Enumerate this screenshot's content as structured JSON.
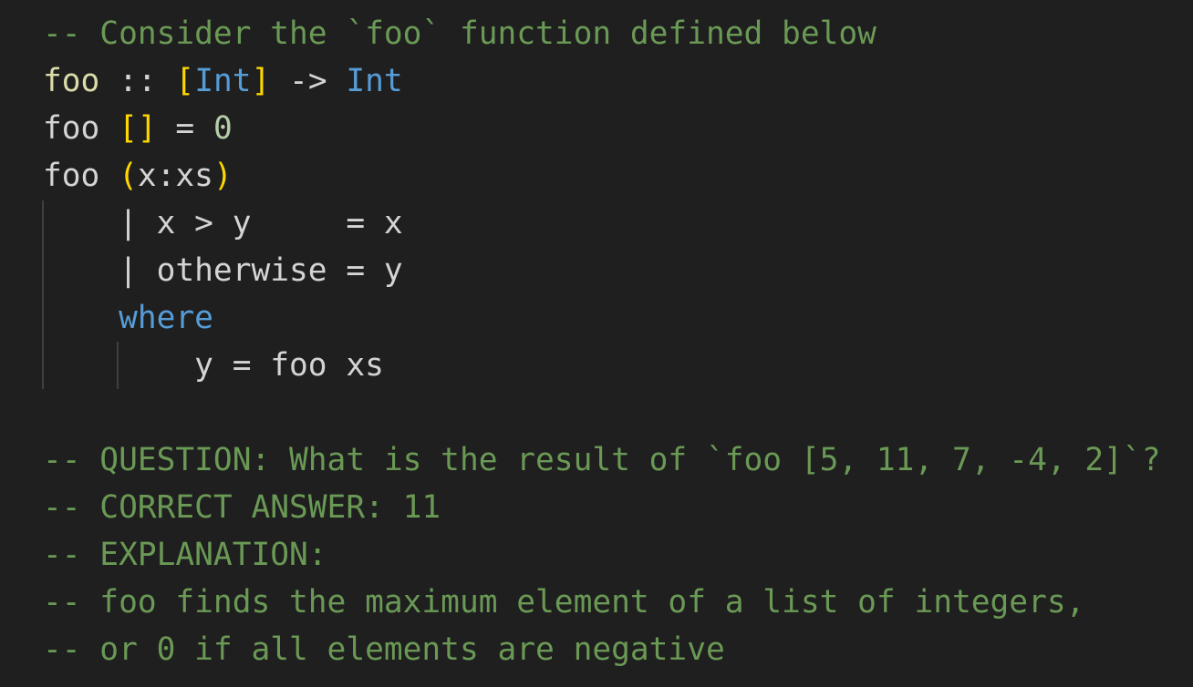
{
  "colors": {
    "background": "#1f1f1f",
    "comment": "#6a9955",
    "function": "#dcdcaa",
    "type": "#569cd6",
    "bracket": "#ffd700",
    "number": "#b5cea8",
    "text": "#d4d4d4",
    "keyword": "#569cd6"
  },
  "lines": [
    [
      [
        "c",
        "-- Consider the `foo` function defined below"
      ]
    ],
    [
      [
        "f",
        "foo"
      ],
      [
        "p",
        " :: "
      ],
      [
        "b",
        "["
      ],
      [
        "t",
        "Int"
      ],
      [
        "b",
        "]"
      ],
      [
        "p",
        " -> "
      ],
      [
        "t",
        "Int"
      ]
    ],
    [
      [
        "p",
        "foo "
      ],
      [
        "b",
        "[]"
      ],
      [
        "p",
        " = "
      ],
      [
        "n",
        "0"
      ]
    ],
    [
      [
        "p",
        "foo "
      ],
      [
        "b",
        "("
      ],
      [
        "p",
        "x:xs"
      ],
      [
        "b",
        ")"
      ]
    ],
    [
      [
        "p",
        "    | x > y     = x"
      ]
    ],
    [
      [
        "p",
        "    | otherwise = y"
      ]
    ],
    [
      [
        "k",
        "    where"
      ]
    ],
    [
      [
        "p",
        "        y = foo xs"
      ]
    ],
    [
      [
        "p",
        ""
      ]
    ],
    [
      [
        "c",
        "-- QUESTION: What is the result of `foo [5, 11, 7, -4, 2]`?"
      ]
    ],
    [
      [
        "c",
        "-- CORRECT ANSWER: 11"
      ]
    ],
    [
      [
        "c",
        "-- EXPLANATION:"
      ]
    ],
    [
      [
        "c",
        "-- foo finds the maximum element of a list of integers,"
      ]
    ],
    [
      [
        "c",
        "-- or 0 if all elements are negative"
      ]
    ]
  ]
}
